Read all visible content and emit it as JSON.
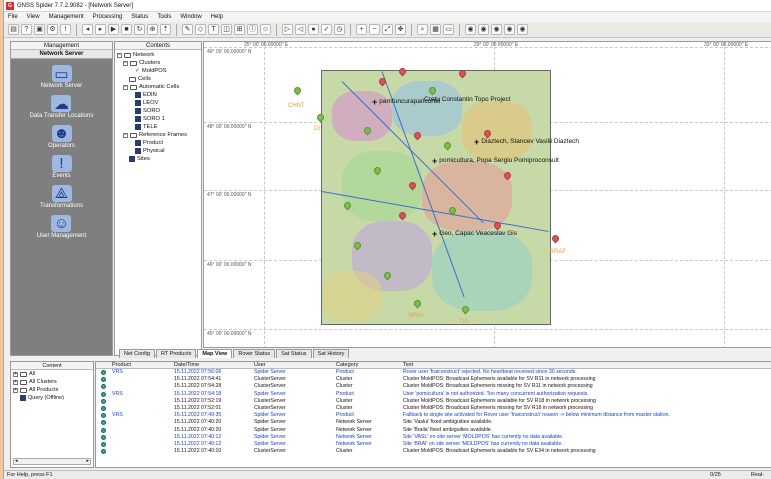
{
  "window": {
    "title": "GNSS Spider 7.7.2.9082 - [Network Server]"
  },
  "menu": [
    "File",
    "View",
    "Management",
    "Processing",
    "Status",
    "Tools",
    "Window",
    "Help"
  ],
  "management": {
    "header": "Management",
    "selected": "Network Server",
    "items": [
      "Network Server",
      "Data Transfer Locations",
      "Operators",
      "Events",
      "Transformations",
      "User Management"
    ]
  },
  "contents": {
    "header": "Contents",
    "tree": {
      "network": "Network",
      "clusters": "Clusters",
      "moldpos": "MoldPOS",
      "cells": "Cells",
      "automatic_cells": "Automatic Cells",
      "edin": "EDIN",
      "leov": "LEOV",
      "soro": "SORO",
      "soro1": "SORO 1",
      "tele": "TELE",
      "reference_frames": "Reference Frames",
      "product": "Product",
      "physical": "Physical",
      "sites": "Sites"
    }
  },
  "map": {
    "coords_top": [
      "25° 00' 00.00000\" E",
      "29° 00' 00.00000\" E",
      "33° 00' 00.00000\" E"
    ],
    "coords_left": [
      "49° 00' 00.00000\" N",
      "48° 00' 00.00000\" N",
      "47° 00' 00.00000\" N",
      "46° 00' 00.00000\" N",
      "45° 00' 00.00000\" N"
    ],
    "site_labels": {
      "chnt": "CHNT",
      "di": "DI",
      "braf": "BRAF",
      "bra1": "BRAI",
      "tia": "TIA"
    },
    "stations": [
      "pamfuncuraparicortel",
      "Cretu Constantin Topo Project",
      "Diaztech, Stancev Vasilii Diaztech",
      "pomicultura, Popa Sergiu Pomiproconsult",
      "Geo, Capac Veaceslav Gis"
    ],
    "tabs": [
      "Net Config",
      "RT Products",
      "Map View",
      "Rover Status",
      "Sat Status",
      "Sat History"
    ],
    "active_tab": "Map View"
  },
  "lower_left": {
    "header": "Content",
    "items": [
      "All",
      "All Clusters",
      "All Products",
      "Query (Offline)"
    ]
  },
  "log": {
    "columns": [
      "Product",
      "Date/Time",
      "User",
      "Category",
      "Text"
    ],
    "rows": [
      {
        "product": "VRS",
        "time": "15.11.2022 07:56:06",
        "user": "Spider Server",
        "category": "Product",
        "text": "Rover user 'fraiconstruct' rejected. No heartbeat received since 30 seconds.",
        "hl": true
      },
      {
        "product": "",
        "time": "15.11.2022 07:54:41",
        "user": "ClusterServer",
        "category": "Cluster",
        "text": "Cluster MoldPOS: Broadcast Ephemeris available for SV R11 in network processing",
        "hl": false
      },
      {
        "product": "",
        "time": "15.11.2022 07:54:28",
        "user": "ClusterServer",
        "category": "Cluster",
        "text": "Cluster MoldPOS: Broadcast Ephemeris missing for SV R11 in network processing",
        "hl": false
      },
      {
        "product": "VRS",
        "time": "15.11.2022 07:54:18",
        "user": "Spider Server",
        "category": "Product",
        "text": "User 'pomicultura' is not authorized. Too many concurrent authorization requests.",
        "hl": true
      },
      {
        "product": "",
        "time": "15.11.2022 07:52:19",
        "user": "ClusterServer",
        "category": "Cluster",
        "text": "Cluster MoldPOS: Broadcast Ephemeris available for SV R18 in network processing",
        "hl": false
      },
      {
        "product": "",
        "time": "15.11.2022 07:52:01",
        "user": "ClusterServer",
        "category": "Cluster",
        "text": "Cluster MoldPOS: Broadcast Ephemeris missing for SV R18 in network processing",
        "hl": false
      },
      {
        "product": "VRS",
        "time": "15.11.2022 07:49:35",
        "user": "Spider Server",
        "category": "Product",
        "text": "Fallback to single site activated for Rover user 'fraiconstruct' reason -> below minimum distance from master station.",
        "hl": true
      },
      {
        "product": "",
        "time": "15.11.2022 07:40:20",
        "user": "Spider Server",
        "category": "Network Server",
        "text": "Site 'Vaslui' fixed ambiguities available.",
        "hl": false
      },
      {
        "product": "",
        "time": "15.11.2022 07:40:20",
        "user": "Spider Server",
        "category": "Network Server",
        "text": "Site 'Braila' fixed ambiguities available.",
        "hl": false
      },
      {
        "product": "",
        "time": "15.11.2022 07:40:12",
        "user": "Spider Server",
        "category": "Network Server",
        "text": "Site 'VASL' on site server 'MOLDPOS' has currently no data available.",
        "hl": true
      },
      {
        "product": "",
        "time": "15.11.2022 07:40:12",
        "user": "Spider Server",
        "category": "Network Server",
        "text": "Site 'BRAI' on site server 'MOLDPOS' has currently no data available.",
        "hl": true
      },
      {
        "product": "",
        "time": "15.11.2022 07:40:10",
        "user": "ClusterServer",
        "category": "Cluster",
        "text": "Cluster MoldPOS: Broadcast Ephemeris available for SV E34 in network processing",
        "hl": false
      }
    ]
  },
  "status": {
    "left": "For Help, press F1",
    "count": "0/25",
    "mode": "Real-"
  },
  "colors": {
    "sidebar": "#7f7f7f",
    "desktop": "#f6c79a",
    "link_blue": "#1a3cc8"
  }
}
